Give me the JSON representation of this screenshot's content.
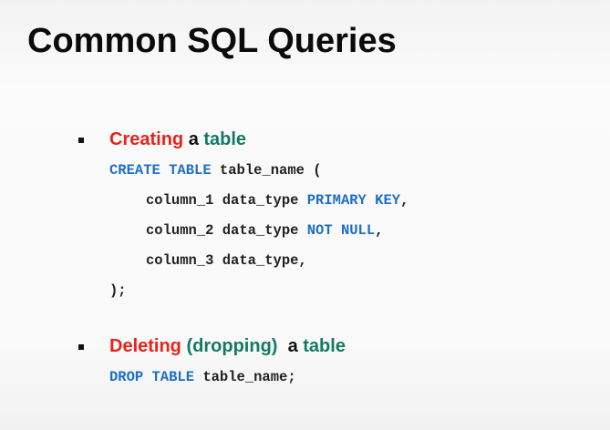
{
  "slide": {
    "title": "Common SQL Queries",
    "sections": [
      {
        "heading": {
          "word1": "Creating",
          "word2": "a",
          "word3": "table"
        },
        "code": [
          {
            "kw1": "CREATE TABLE",
            "rest": " table_name ("
          },
          {
            "pre": "column_1 data_type ",
            "kw": "PRIMARY KEY",
            "post": ","
          },
          {
            "pre": "column_2 data_type ",
            "kw": "NOT NULL",
            "post": ","
          },
          {
            "pre": "column_3 data_type,",
            "kw": "",
            "post": ""
          },
          {
            "pre": ");",
            "kw": "",
            "post": ""
          }
        ]
      },
      {
        "heading": {
          "word1": "Deleting",
          "paren_open": "(",
          "word2": "dropping",
          "paren_close": ")",
          "word3": "a",
          "word4": "table"
        },
        "code": [
          {
            "kw1": "DROP TABLE",
            "rest": " table_name;"
          }
        ]
      }
    ]
  },
  "colors": {
    "red": "#e8221a",
    "teal": "#137a63",
    "keyword_blue": "#1d6fc4",
    "text": "#111111"
  }
}
